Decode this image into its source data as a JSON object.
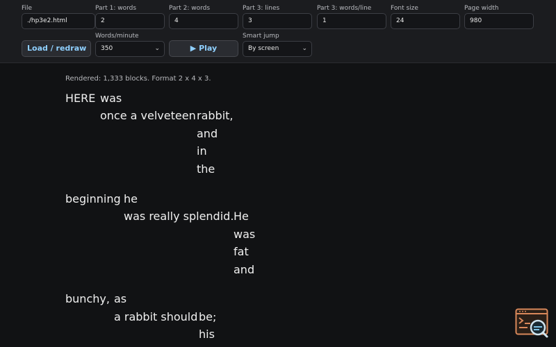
{
  "toolbar": {
    "file": {
      "label": "File",
      "value": "./hp3e2.html"
    },
    "part1_words": {
      "label": "Part 1: words",
      "value": "2"
    },
    "part2_words": {
      "label": "Part 2: words",
      "value": "4"
    },
    "part3_lines": {
      "label": "Part 3: lines",
      "value": "3"
    },
    "part3_words_per_line": {
      "label": "Part 3: words/line",
      "value": "1"
    },
    "font_size": {
      "label": "Font size",
      "value": "24"
    },
    "page_width": {
      "label": "Page width",
      "value": "980"
    },
    "load_button": "Load / redraw",
    "words_per_minute": {
      "label": "Words/minute",
      "value": "350"
    },
    "play_button": "▶ Play",
    "smart_jump": {
      "label": "Smart jump",
      "value": "By screen"
    }
  },
  "status": "Rendered: 1,333 blocks. Format 2 x 4 x 3.",
  "blocks": [
    {
      "p1": [
        "HERE",
        "was"
      ],
      "p2": "once a velveteen",
      "p3": [
        "rabbit,",
        "and",
        "in",
        "the"
      ]
    },
    {
      "p1": [
        "beginning",
        "he"
      ],
      "p2": "was really splendid.",
      "p3": [
        "He",
        "was",
        "fat",
        "and"
      ]
    },
    {
      "p1": [
        "bunchy,",
        "as"
      ],
      "p2": "a rabbit should",
      "p3": [
        "be;",
        "his"
      ]
    }
  ],
  "icons": {
    "corner": "terminal-search-icon"
  }
}
